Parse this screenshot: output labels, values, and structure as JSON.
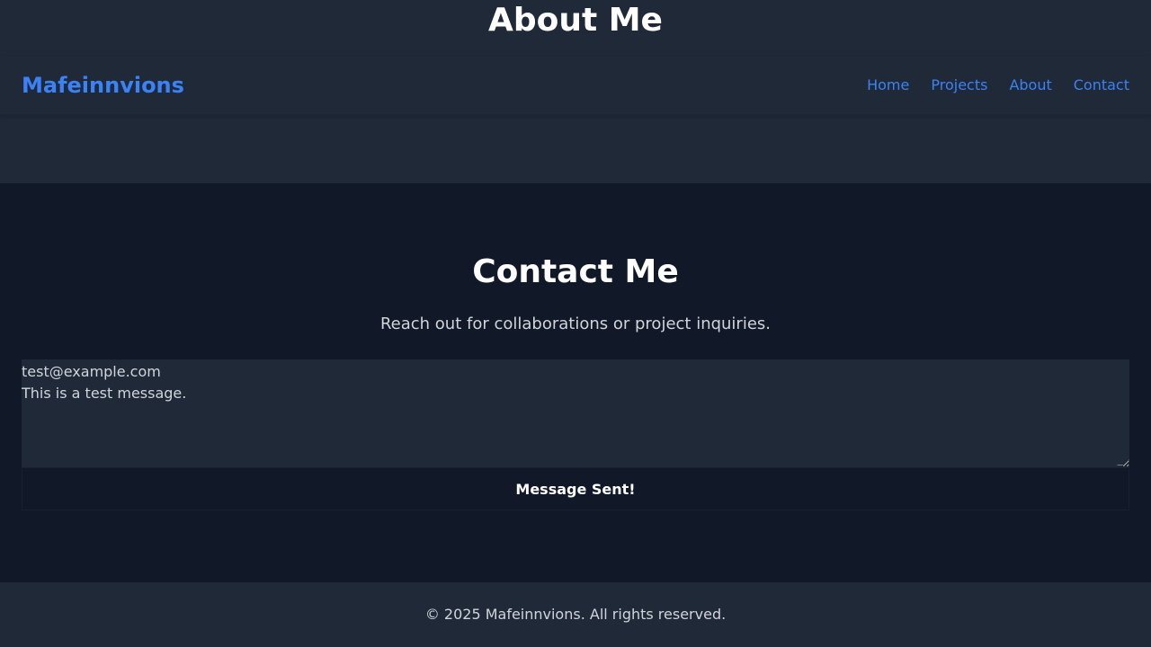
{
  "about": {
    "title": "About Me"
  },
  "navbar": {
    "brand": "Mafeinnvions",
    "links": [
      {
        "label": "Home"
      },
      {
        "label": "Projects"
      },
      {
        "label": "About"
      },
      {
        "label": "Contact"
      }
    ]
  },
  "contact": {
    "title": "Contact Me",
    "subtitle": "Reach out for collaborations or project inquiries.",
    "message_lines": [
      "test@example.com",
      "This is a test message."
    ],
    "submit_label": "Message Sent!"
  },
  "footer": {
    "text": "© 2025 Mafeinnvions. All rights reserved."
  },
  "colors": {
    "accent": "#3b82f6",
    "background": "#111827",
    "surface": "#1f2937",
    "text_muted": "#d1d5db",
    "text_primary": "#ffffff"
  }
}
